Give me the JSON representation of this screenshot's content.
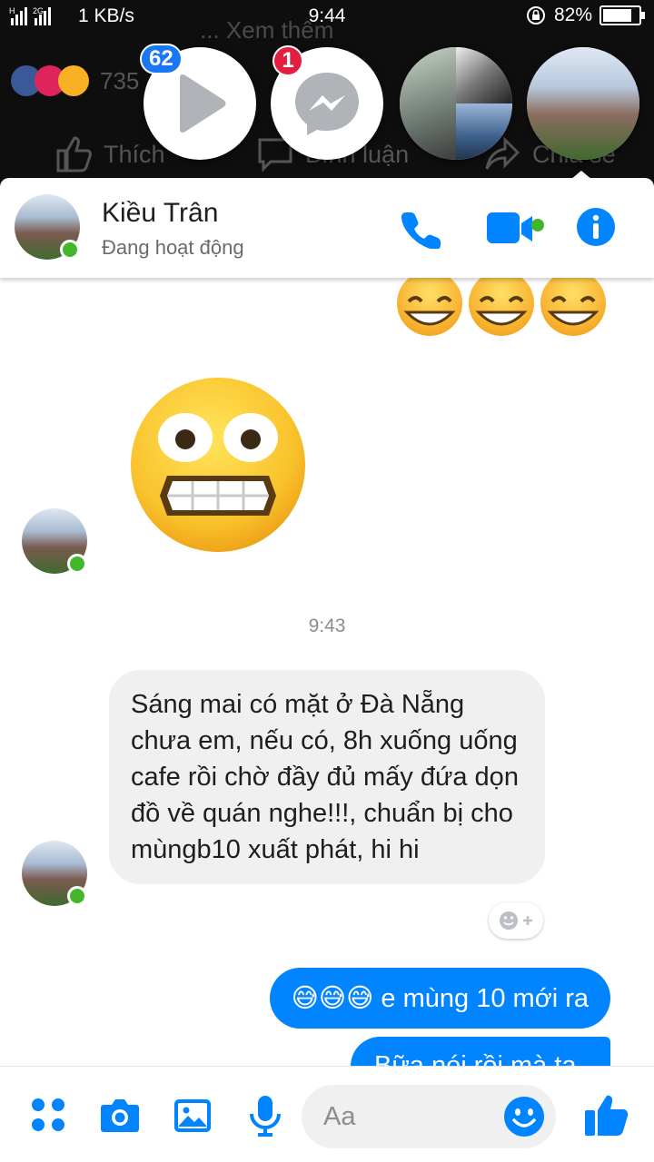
{
  "status_bar": {
    "network": "1 KB/s",
    "time": "9:44",
    "battery": "82%",
    "battery_level": 0.82
  },
  "background": {
    "partial_text": "... Xem thêm",
    "reaction_count": "735",
    "like_label": "Thích",
    "comment_label": "Bình luận",
    "share_label": "Chia sẻ"
  },
  "chat_heads": {
    "video_badge": "62",
    "messenger_badge": "1"
  },
  "header": {
    "name": "Kiều Trân",
    "status": "Đang hoạt động"
  },
  "conversation": {
    "timestamp": "9:43",
    "incoming_message": "Sáng mai có mặt ở Đà Nẵng chưa em, nếu có, 8h xuống uống cafe rồi chờ đầy đủ mấy đứa dọn đồ về quán nghe!!!, chuẩn bị cho mùngb10 xuất phát, hi hi",
    "outgoing_messages": [
      {
        "emoji": "😅😅😅",
        "text": " e mùng 10 mới ra"
      },
      {
        "text": "Bữa nói rồi mà ta"
      }
    ]
  },
  "composer": {
    "placeholder": "Aa"
  },
  "colors": {
    "accent": "#0084ff",
    "online": "#42b72a",
    "badge": "#1877f2",
    "badge_red": "#e41e3f"
  },
  "icons": [
    "play-icon",
    "messenger-icon",
    "phone-icon",
    "video-camera-icon",
    "info-icon",
    "apps-icon",
    "camera-icon",
    "gallery-icon",
    "microphone-icon",
    "smiley-icon",
    "thumbs-up-icon"
  ]
}
